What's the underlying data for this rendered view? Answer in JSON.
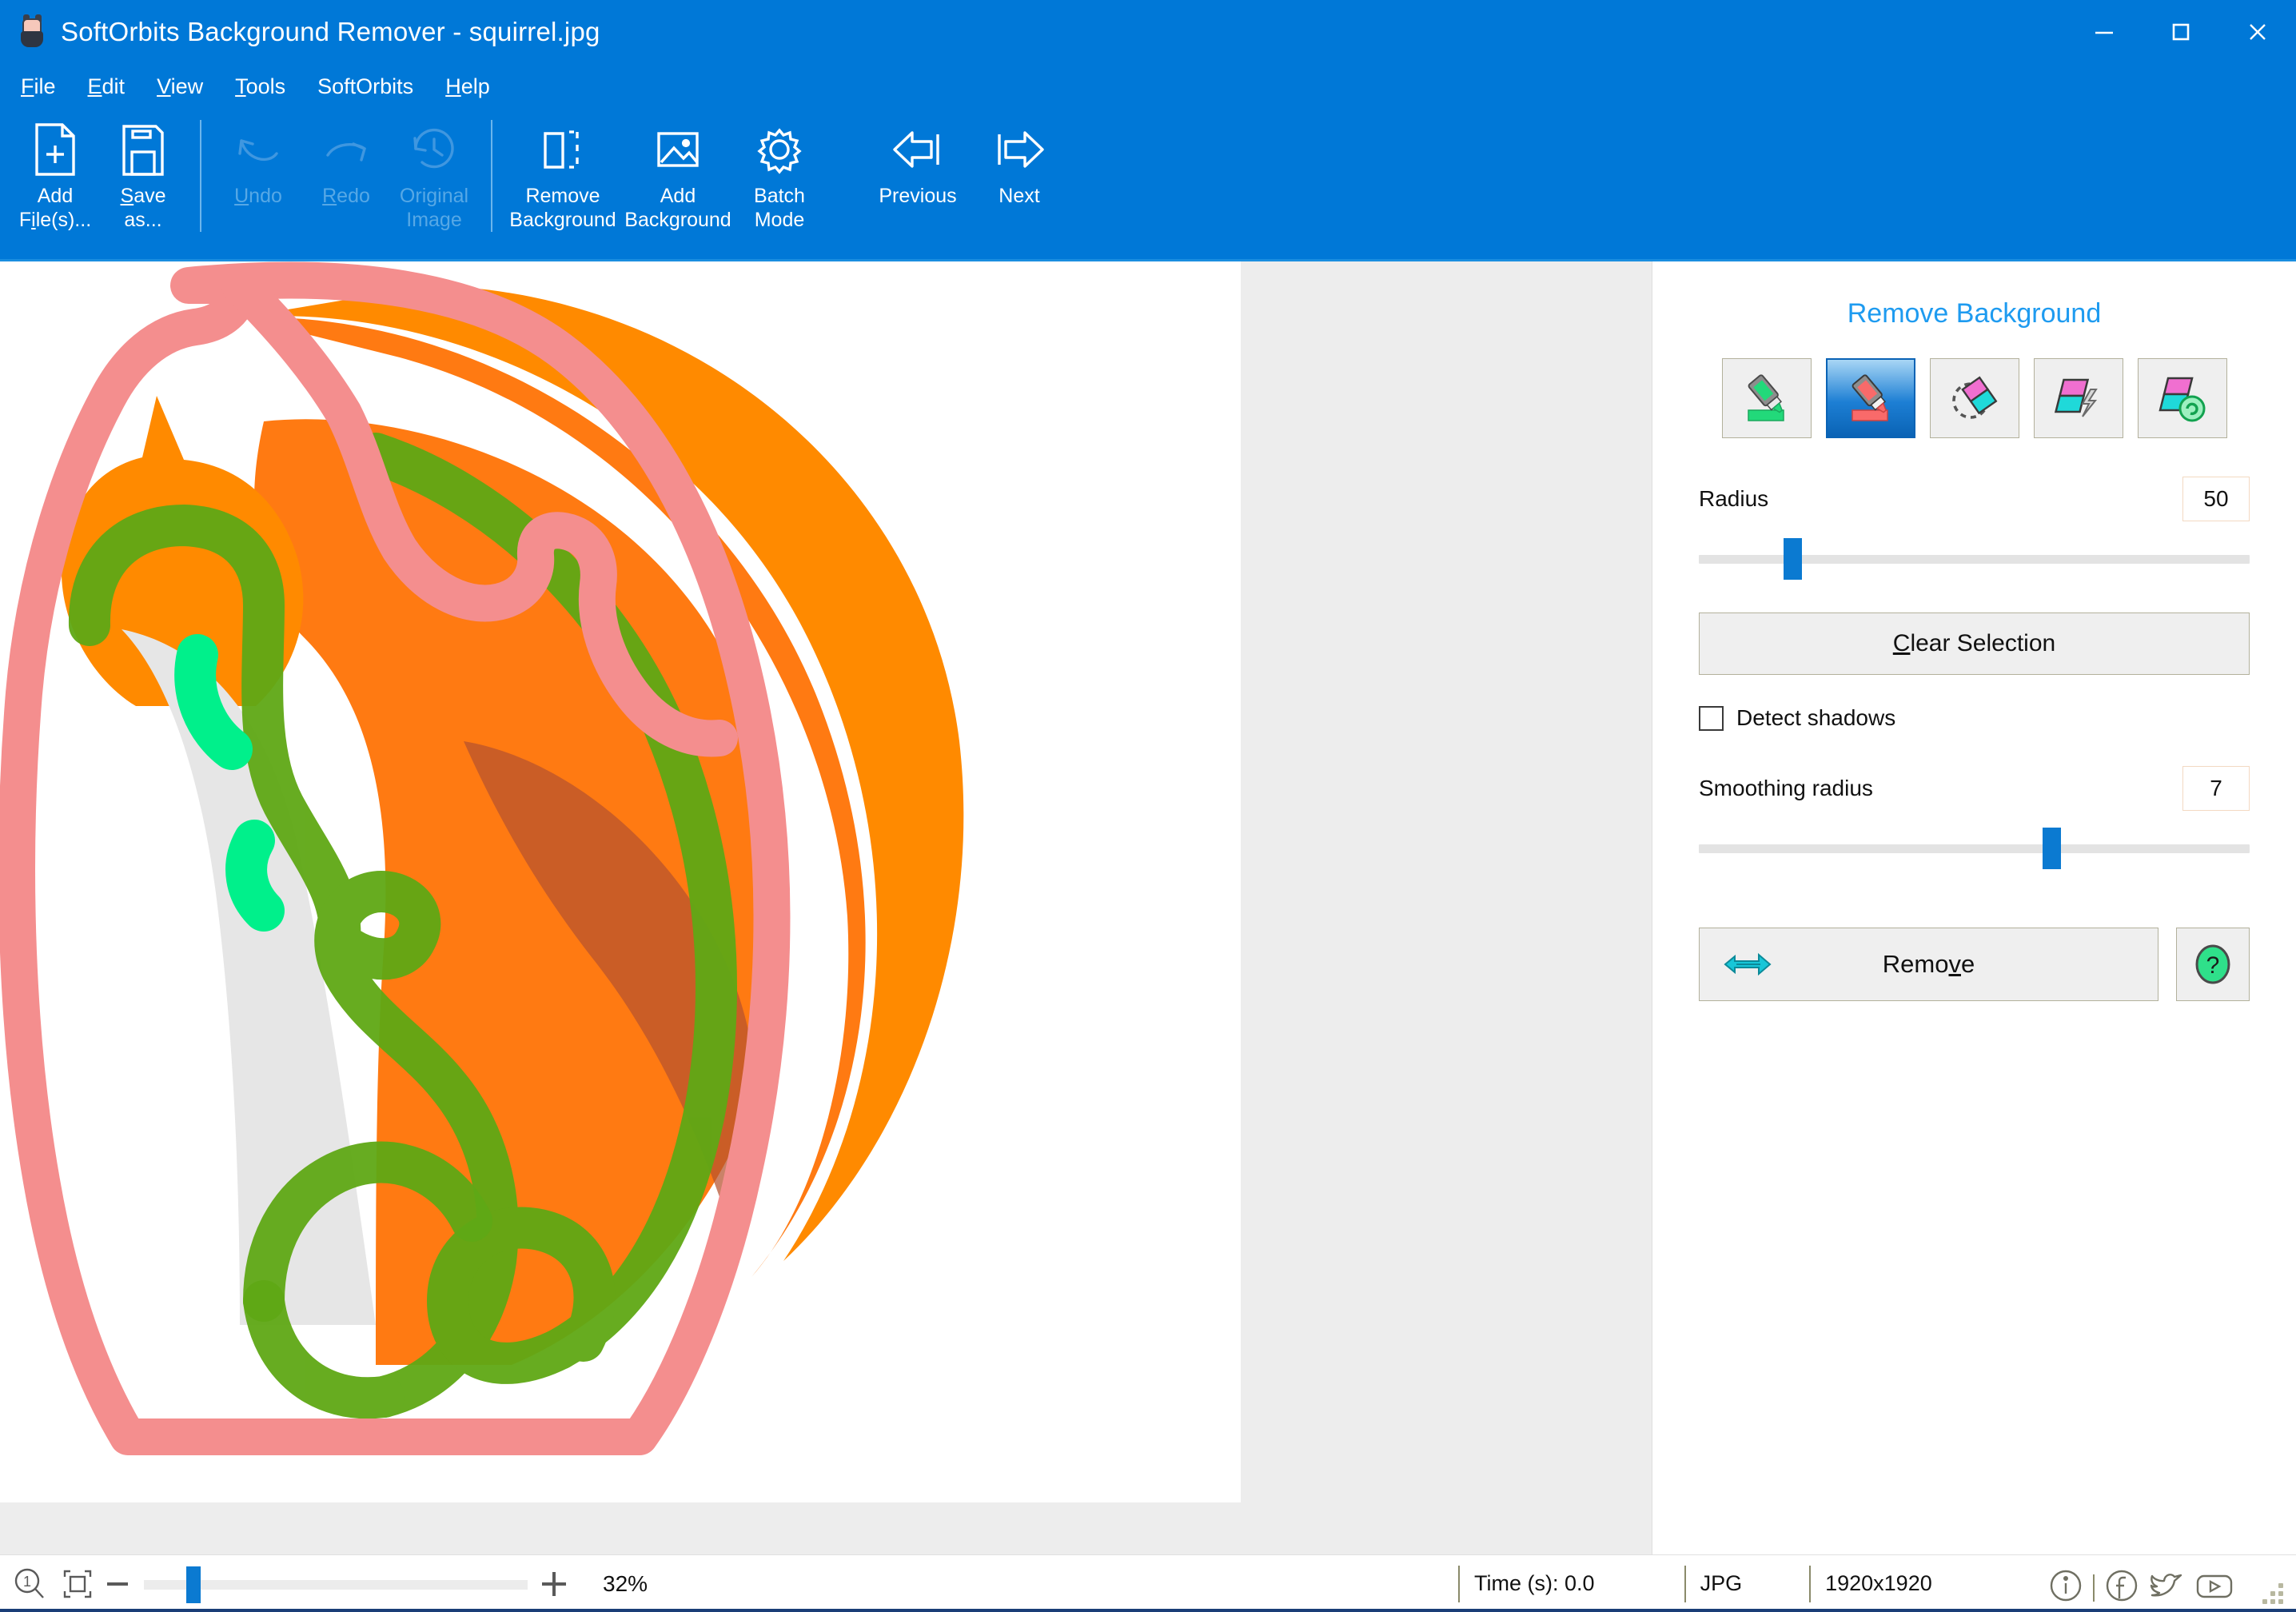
{
  "window": {
    "title": "SoftOrbits Background Remover - squirrel.jpg",
    "app_icon": "squirrel-icon",
    "minimize_label": "–",
    "maximize_label": "□",
    "close_label": "✕",
    "titlebar_color": "#0078D7"
  },
  "menu": {
    "items": [
      {
        "label": "File",
        "mnemonic": "F"
      },
      {
        "label": "Edit",
        "mnemonic": "E"
      },
      {
        "label": "View",
        "mnemonic": "V"
      },
      {
        "label": "Tools",
        "mnemonic": "T"
      },
      {
        "label": "SoftOrbits",
        "mnemonic": ""
      },
      {
        "label": "Help",
        "mnemonic": "H"
      }
    ]
  },
  "toolbar": {
    "items": [
      {
        "id": "add-files",
        "line1": "Add",
        "line2": "File(s)...",
        "icon": "add-file-icon",
        "enabled": true,
        "mnemonic": "i"
      },
      {
        "id": "save-as",
        "line1": "Save",
        "line2": "as...",
        "icon": "save-icon",
        "enabled": true,
        "mnemonic": "S"
      },
      {
        "id": "undo",
        "line1": "Undo",
        "line2": "",
        "icon": "undo-icon",
        "enabled": false,
        "mnemonic": "U"
      },
      {
        "id": "redo",
        "line1": "Redo",
        "line2": "",
        "icon": "redo-icon",
        "enabled": false,
        "mnemonic": "R"
      },
      {
        "id": "original-image",
        "line1": "Original",
        "line2": "Image",
        "icon": "history-icon",
        "enabled": false,
        "mnemonic": ""
      },
      {
        "id": "remove-background",
        "line1": "Remove",
        "line2": "Background",
        "icon": "remove-background-icon",
        "enabled": true,
        "mnemonic": ""
      },
      {
        "id": "add-background",
        "line1": "Add",
        "line2": "Background",
        "icon": "picture-icon",
        "enabled": true,
        "mnemonic": ""
      },
      {
        "id": "batch-mode",
        "line1": "Batch",
        "line2": "Mode",
        "icon": "gear-icon",
        "enabled": true,
        "mnemonic": ""
      },
      {
        "id": "previous",
        "line1": "Previous",
        "line2": "",
        "icon": "arrow-left-icon",
        "enabled": true,
        "mnemonic": ""
      },
      {
        "id": "next",
        "line1": "Next",
        "line2": "",
        "icon": "arrow-right-icon",
        "enabled": true,
        "mnemonic": ""
      }
    ]
  },
  "panel": {
    "title": "Remove Background",
    "title_color": "#1e9bf0",
    "tools": [
      {
        "id": "keep-marker",
        "icon": "green-marker-icon",
        "selected": false
      },
      {
        "id": "remove-marker",
        "icon": "red-marker-icon",
        "selected": true
      },
      {
        "id": "eraser",
        "icon": "eraser-icon",
        "selected": false
      },
      {
        "id": "magic-wand",
        "icon": "auto-lightning-icon",
        "selected": false
      },
      {
        "id": "restore",
        "icon": "restore-refresh-icon",
        "selected": false
      }
    ],
    "radius": {
      "label": "Radius",
      "value": "50",
      "thumb_percent": 17
    },
    "clear_selection": {
      "label": "Clear Selection",
      "mnemonic": "C"
    },
    "detect_shadows": {
      "label": "Detect shadows",
      "checked": false
    },
    "smoothing_radius": {
      "label": "Smoothing radius",
      "value": "7",
      "thumb_percent": 64
    },
    "remove": {
      "label": "Remove",
      "mnemonic": "v",
      "icon": "arrow-right-cyan-icon"
    },
    "help": {
      "icon": "help-question-icon",
      "label": "?"
    }
  },
  "statusbar": {
    "zoom_one_to_one_icon": "zoom-1to1-icon",
    "fit_window_icon": "fit-to-window-icon",
    "minus_label": "–",
    "plus_label": "+",
    "zoom_percent": "32%",
    "zoom_thumb_percent": 13,
    "time": "Time (s): 0.0",
    "format": "JPG",
    "dimensions": "1920x1920",
    "social": [
      {
        "id": "info",
        "icon": "info-icon"
      },
      {
        "id": "facebook",
        "icon": "facebook-icon"
      },
      {
        "id": "twitter",
        "icon": "twitter-icon"
      },
      {
        "id": "youtube",
        "icon": "youtube-icon"
      }
    ]
  },
  "canvas": {
    "background_color": "#EDEDED",
    "sheet_color": "#FFFFFF",
    "foreground_stroke_color": "#5FA815",
    "background_stroke_color": "#F48E8E",
    "highlight_stroke_color": "#00F08B",
    "subject_color_light": "#FF8A00",
    "subject_color_mid": "#FF6A1E",
    "subject_shadow_color": "#E0E0E0",
    "subject_dark_color": "#B5522E"
  }
}
